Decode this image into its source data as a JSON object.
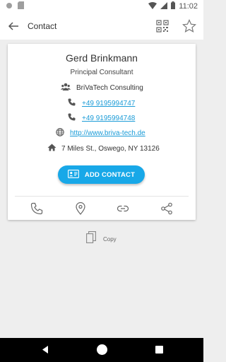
{
  "status_bar": {
    "time": "11:02"
  },
  "app_bar": {
    "title": "Contact"
  },
  "contact": {
    "name": "Gerd Brinkmann",
    "job_title": "Principal Consultant",
    "company": "BriVaTech Consulting",
    "phone_1": "+49 9195994747",
    "phone_2": "+49 9195994748",
    "website": "http://www.briva-tech.de",
    "address": "7 Miles St., Oswego, NY 13126"
  },
  "add_button": {
    "label": "ADD CONTACT"
  },
  "copy": {
    "label": "Copy"
  },
  "colors": {
    "accent": "#18a8e8",
    "link": "#1a9bd7",
    "background": "#eeeeee"
  },
  "icons": [
    "back-arrow-icon",
    "qr-code-icon",
    "star-icon",
    "group-icon",
    "phone-icon",
    "globe-icon",
    "home-icon",
    "contact-card-icon",
    "location-pin-icon",
    "link-icon",
    "share-icon",
    "copy-icon"
  ]
}
